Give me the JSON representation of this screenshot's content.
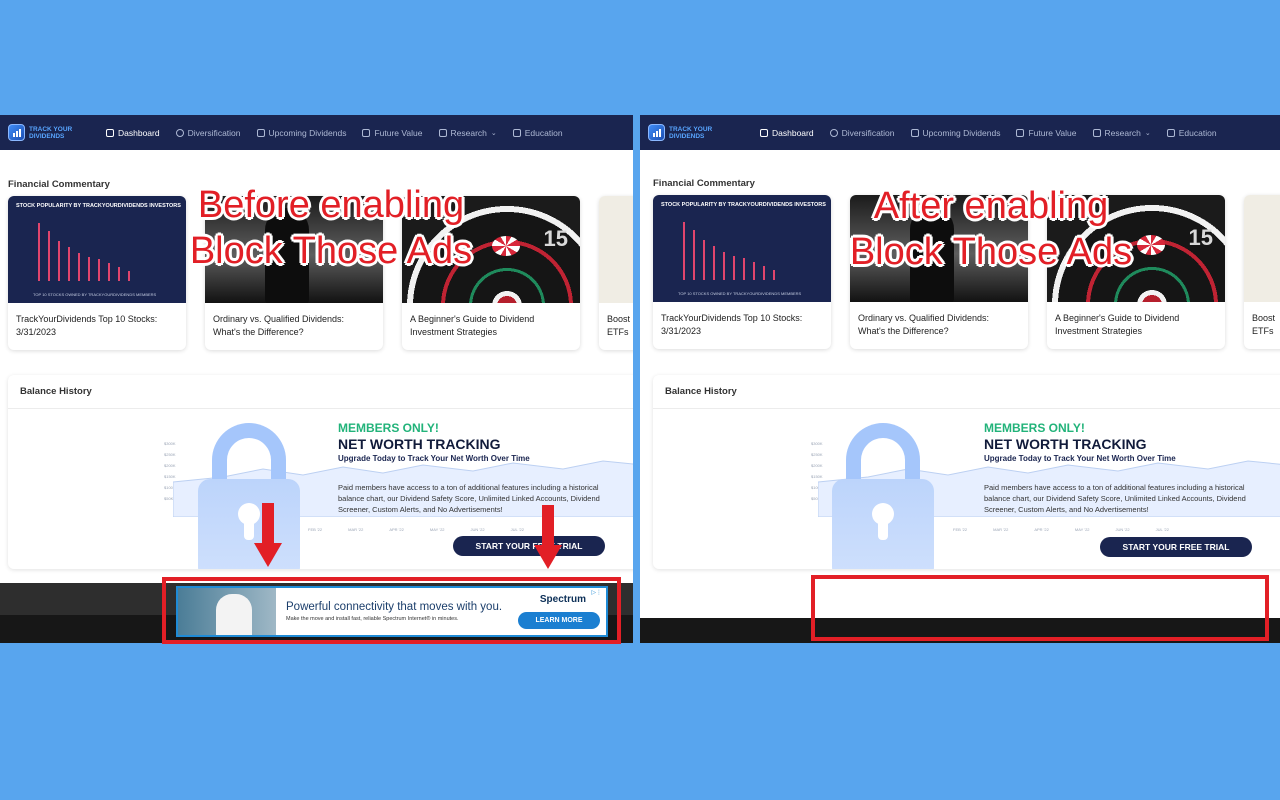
{
  "brand": {
    "logo_line1": "Track Your",
    "logo_line2": "Dividends"
  },
  "nav": [
    {
      "label": "Dashboard",
      "active": true
    },
    {
      "label": "Diversification"
    },
    {
      "label": "Upcoming Dividends"
    },
    {
      "label": "Future Value"
    },
    {
      "label": "Research"
    },
    {
      "label": "Education"
    }
  ],
  "commentary": {
    "title": "Financial Commentary",
    "cards": [
      {
        "title_line1": "TrackYourDividends Top 10 Stocks:",
        "title_line2": "3/31/2023",
        "thumb_title": "STOCK POPULARITY BY TRACKYOURDIVIDENDS INVESTORS",
        "thumb_footer": "TOP 10 STOCKS OWNED BY TRACKYOURDIVIDENDS MEMBERS"
      },
      {
        "title_line1": "Ordinary vs. Qualified Dividends:",
        "title_line2": "What's the Difference?"
      },
      {
        "title_line1": "A Beginner's Guide to Dividend",
        "title_line2": "Investment Strategies",
        "thumb_number": "15"
      },
      {
        "title_line1": "Boost",
        "title_line2": "ETFs"
      }
    ]
  },
  "balance": {
    "title": "Balance History",
    "y_ticks": [
      "$300K",
      "$250K",
      "$200K",
      "$150K",
      "$100K",
      "$50K"
    ],
    "x_ticks": [
      "FEB '22",
      "MAR '22",
      "APR '22",
      "MAY '22",
      "JUN '22",
      "JUL '22"
    ],
    "promo": {
      "members_only": "MEMBERS ONLY!",
      "title": "NET WORTH TRACKING",
      "subtitle": "Upgrade Today to Track Your Net Worth Over Time",
      "description": "Paid members have access to a ton of additional features including a historical balance chart, our Dividend Safety Score, Unlimited Linked Accounts, Dividend Screener, Custom Alerts, and No Advertisements!",
      "cta": "START YOUR FREE TRIAL"
    }
  },
  "ad": {
    "headline": "Powerful connectivity that moves with you.",
    "small_print": "Make the move and install fast, reliable Spectrum Internet® in minutes.",
    "brand": "Spectrum",
    "cta": "LEARN MORE"
  },
  "overlays": {
    "before_line1": "Before enabling",
    "before_line2": "Block Those Ads",
    "after_line1": "After enabling",
    "after_line2": "Block Those Ads"
  },
  "colors": {
    "page_background": "#58a5ee",
    "nav_background": "#1a2550",
    "annotation_red": "#e21f26",
    "members_green": "#22b37a",
    "lock_blue": "#a5c6fb",
    "ad_button_blue": "#1b7fd1"
  },
  "icons": {
    "dashboard": "home-icon",
    "diversification": "pie-chart-icon",
    "upcoming": "calendar-icon",
    "future": "trend-line-icon",
    "research": "table-icon",
    "education": "graduation-cap-icon"
  }
}
